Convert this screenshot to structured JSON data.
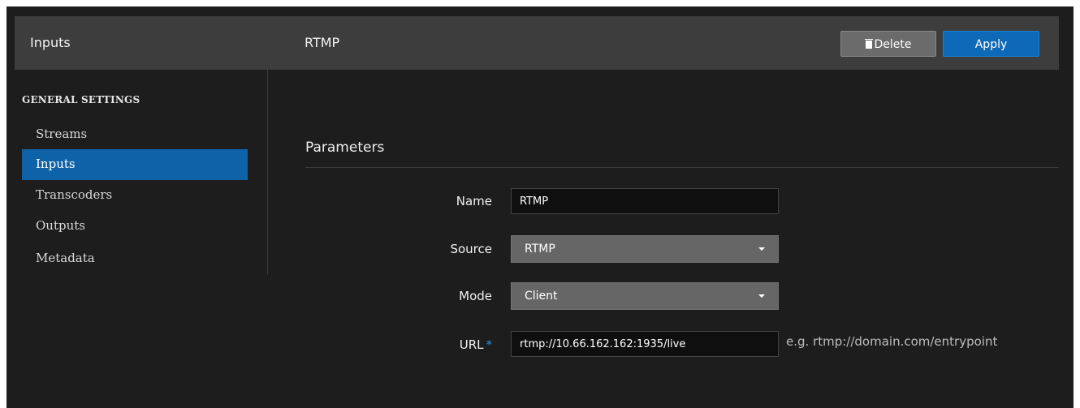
{
  "header": {
    "left_title": "Inputs",
    "right_title": "RTMP",
    "delete_label": "Delete",
    "apply_label": "Apply"
  },
  "sidebar": {
    "heading": "GENERAL SETTINGS",
    "items": [
      {
        "label": "Streams",
        "active": false
      },
      {
        "label": "Inputs",
        "active": true
      },
      {
        "label": "Transcoders",
        "active": false
      },
      {
        "label": "Outputs",
        "active": false
      },
      {
        "label": "Metadata",
        "active": false
      }
    ]
  },
  "parameters": {
    "title": "Parameters",
    "name": {
      "label": "Name",
      "value": "RTMP"
    },
    "source": {
      "label": "Source",
      "value": "RTMP"
    },
    "mode": {
      "label": "Mode",
      "value": "Client"
    },
    "url": {
      "label": "URL",
      "required_marker": "*",
      "value": "rtmp://10.66.162.162:1935/live",
      "hint": "e.g. rtmp://domain.com/entrypoint"
    }
  },
  "colors": {
    "accent": "#0e6ab8",
    "background": "#1d1d1d",
    "header": "#3d3d3d"
  },
  "icons": {
    "delete": "trash-icon",
    "dropdown": "caret-down-icon"
  }
}
